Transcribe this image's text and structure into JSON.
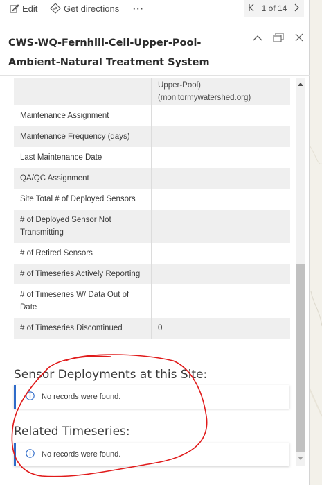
{
  "toolbar": {
    "edit_label": "Edit",
    "directions_label": "Get directions",
    "more_label": "···",
    "pager_text": "1 of 14"
  },
  "header": {
    "title": "CWS-WQ-Fernhill-Cell-Upper-Pool-Ambient-Natural Treatment System"
  },
  "top_value": {
    "line1": "Upper-Pool)",
    "line2": "(monitormywatershed.org)"
  },
  "attributes": [
    {
      "key": "Maintenance Assignment",
      "value": ""
    },
    {
      "key": "Maintenance Frequency (days)",
      "value": ""
    },
    {
      "key": "Last Maintenance Date",
      "value": ""
    },
    {
      "key": "QA/QC Assignment",
      "value": ""
    },
    {
      "key": "Site Total # of Deployed Sensors",
      "value": ""
    },
    {
      "key": "# of Deployed Sensor Not Transmitting",
      "value": ""
    },
    {
      "key": "# of Retired Sensors",
      "value": ""
    },
    {
      "key": "# of Timeseries Actively Reporting",
      "value": ""
    },
    {
      "key": "# of Timeseries W/ Data Out of Date",
      "value": ""
    },
    {
      "key": "# of Timeseries Discontinued",
      "value": "0"
    }
  ],
  "sections": [
    {
      "title": "Sensor Deployments at this Site:",
      "notice": "No records were found."
    },
    {
      "title": "Related Timeseries:",
      "notice": "No records were found."
    }
  ],
  "colors": {
    "accent_bar": "#2f6bc9",
    "info_icon": "#2f6bc9",
    "annotation": "#e01a1a"
  },
  "icons": {
    "edit": "edit-icon",
    "directions": "directions-icon",
    "pager_prev": "chevron-left-icon",
    "pager_next": "chevron-right-icon",
    "collapse": "chevron-up-icon",
    "dock": "dock-icon",
    "close": "close-icon",
    "info": "info-icon"
  }
}
